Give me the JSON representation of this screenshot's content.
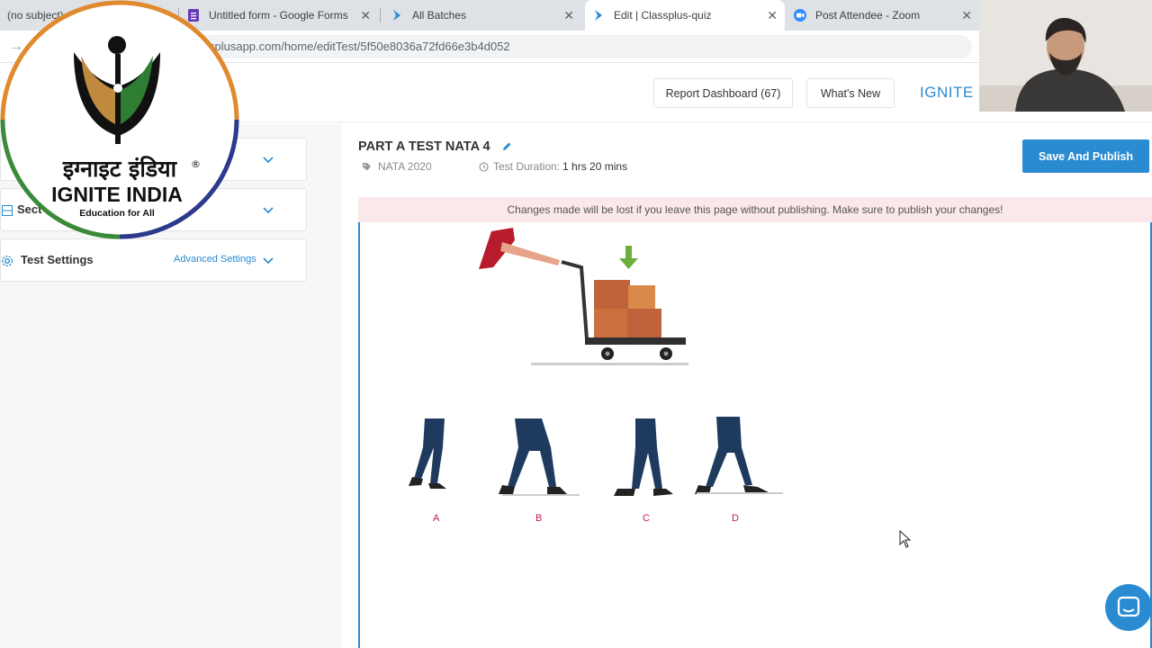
{
  "browser": {
    "tabs": [
      {
        "title": "(no subject)",
        "icon": "mail-icon"
      },
      {
        "title": "Untitled form - Google Forms",
        "icon": "google-forms-icon"
      },
      {
        "title": "All Batches",
        "icon": "classplus-icon"
      },
      {
        "title": "Edit | Classplus-quiz",
        "icon": "classplus-icon",
        "active": true
      },
      {
        "title": "Post Attendee - Zoom",
        "icon": "zoom-icon"
      }
    ],
    "close_glyph": "✕",
    "url": "splusapp.com/home/editTest/5f50e8036a72fd66e3b4d052"
  },
  "header": {
    "report_dashboard": "Report Dashboard (67)",
    "whats_new": "What's New",
    "brand": "IGNITE"
  },
  "sidebar": {
    "items": [
      {
        "label": ""
      },
      {
        "label": "Sect"
      },
      {
        "label": "Test Settings",
        "link": "Advanced Settings"
      }
    ]
  },
  "test": {
    "title": "PART A TEST NATA 4",
    "tag": "NATA 2020",
    "duration_label": "Test Duration:",
    "duration_value": "1 hrs 20 mins",
    "save_button": "Save And Publish",
    "warning": "Changes made will be lost if you leave this page without publishing. Make sure to publish your changes!"
  },
  "question": {
    "options": [
      "A",
      "B",
      "C",
      "D"
    ]
  },
  "logo": {
    "hindi_text": "इग्नाइट इंडिया",
    "english_text": "IGNITE INDIA",
    "tagline": "Education for All",
    "registered": "®"
  },
  "colors": {
    "accent": "#2b8bd1",
    "warning_bg": "#fbe8ea",
    "option_label": "#c2185b"
  }
}
